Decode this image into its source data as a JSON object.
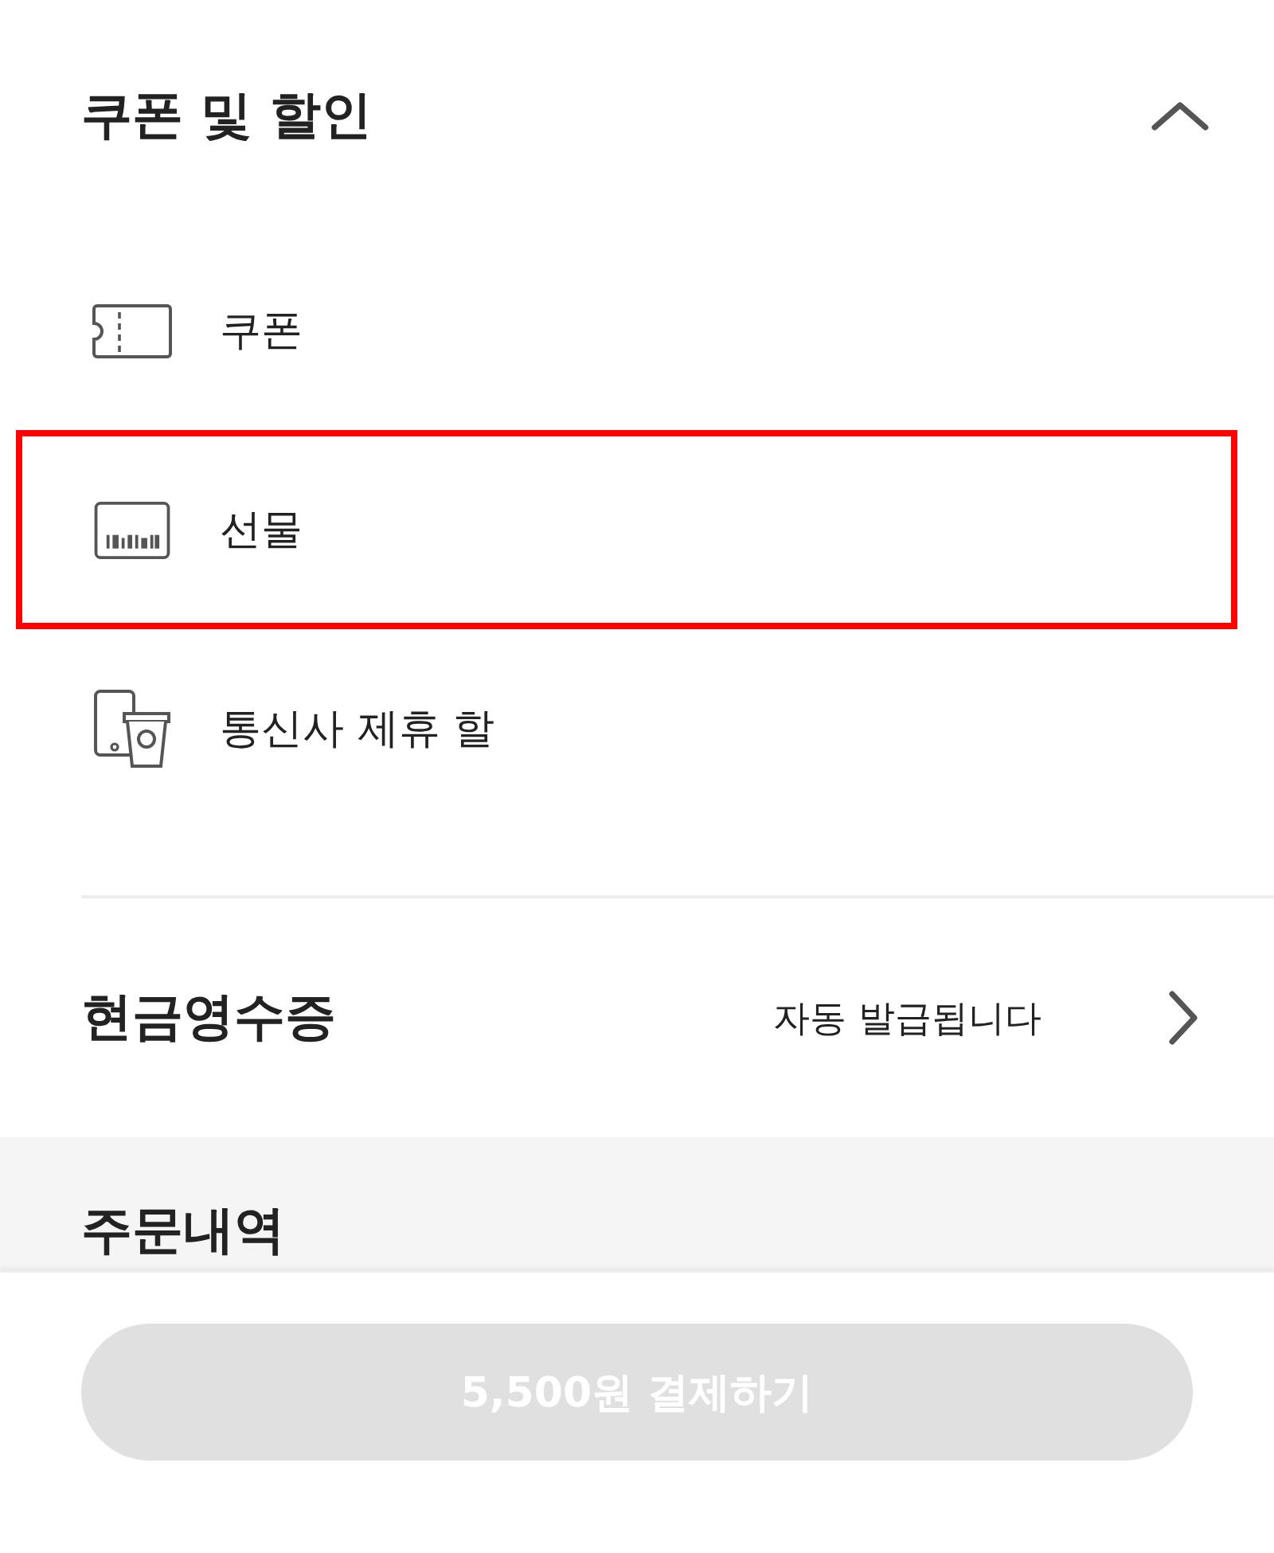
{
  "coupon_section": {
    "title": "쿠폰 및 할인",
    "expanded": true,
    "items": [
      {
        "kind": "coupon",
        "label": "쿠폰",
        "highlighted": false
      },
      {
        "kind": "gift",
        "label": "선물",
        "highlighted": true
      },
      {
        "kind": "telecom",
        "label": "통신사 제휴 할",
        "highlighted": false
      }
    ]
  },
  "cash_receipt": {
    "title": "현금영수증",
    "value": "자동 발급됩니다"
  },
  "order_history": {
    "title": "주문내역"
  },
  "pay_button": {
    "label": "5,500원 결제하기",
    "disabled": true
  }
}
